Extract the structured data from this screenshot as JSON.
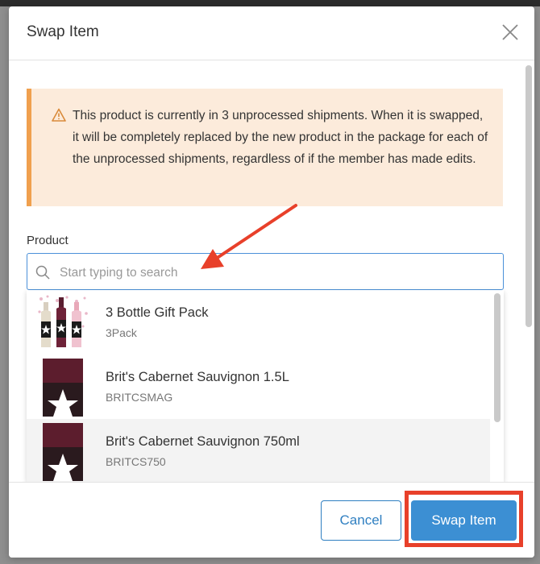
{
  "modal": {
    "title": "Swap Item"
  },
  "alert": {
    "icon": "warning-icon",
    "text": "This product is currently in 3 unprocessed shipments. When it is swapped, it will be completely replaced by the new product in the package for each of the unprocessed shipments, regardless of if the member has made edits."
  },
  "product_field": {
    "label": "Product",
    "value": "",
    "placeholder": "Start typing to search"
  },
  "dropdown": {
    "items": [
      {
        "name": "3 Bottle Gift Pack",
        "sku": "3Pack"
      },
      {
        "name": "Brit's Cabernet Sauvignon 1.5L",
        "sku": "BRITCSMAG"
      },
      {
        "name": "Brit's Cabernet Sauvignon 750ml",
        "sku": "BRITCS750"
      }
    ]
  },
  "footer": {
    "cancel_label": "Cancel",
    "swap_label": "Swap Item"
  },
  "colors": {
    "accent": "#3c8fd3",
    "alert_bg": "#fcebdb",
    "alert_border": "#f0a04e",
    "annotation": "#e8402a"
  }
}
